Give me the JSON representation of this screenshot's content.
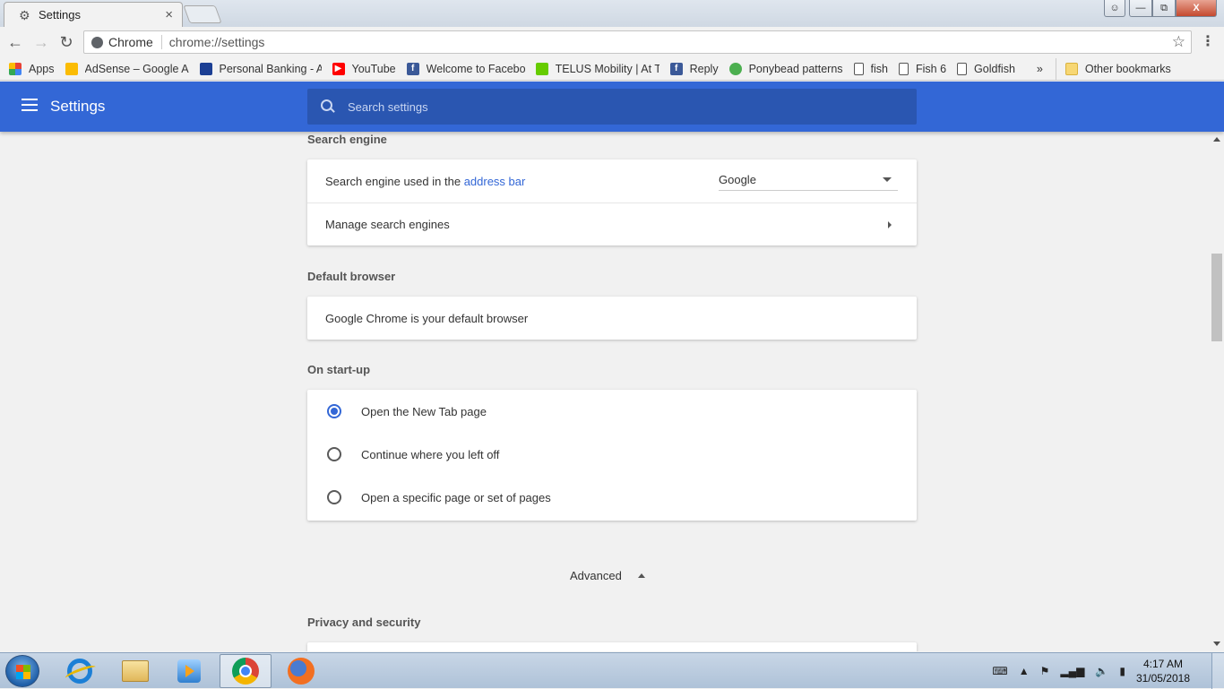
{
  "window": {
    "tab_title": "Settings",
    "tab_close": "×",
    "controls": {
      "close": "X"
    }
  },
  "toolbar": {
    "back": "←",
    "forward": "→",
    "reload": "↻",
    "site_name": "Chrome",
    "url": "chrome://settings",
    "star": "☆",
    "menu": "⋮"
  },
  "bookmarks": {
    "items": [
      {
        "label": "Apps",
        "icon": "apps-grid-icon",
        "color": "#e94235"
      },
      {
        "label": "AdSense – Google A",
        "icon": "adsense-icon",
        "color": "#fbbc04"
      },
      {
        "label": "Personal Banking - A",
        "icon": "rbc-icon",
        "color": "#1c3f94"
      },
      {
        "label": "YouTube",
        "icon": "youtube-icon",
        "color": "#ff0000"
      },
      {
        "label": "Welcome to Faceboo",
        "icon": "facebook-icon",
        "color": "#3b5998"
      },
      {
        "label": "TELUS Mobility | At T",
        "icon": "telus-icon",
        "color": "#66cc00"
      },
      {
        "label": "Reply",
        "icon": "facebook-icon",
        "color": "#3b5998"
      },
      {
        "label": "Ponybead patterns",
        "icon": "ponybead-icon",
        "color": "#4caf50"
      },
      {
        "label": "fish",
        "icon": "page-icon",
        "color": "#ffffff"
      },
      {
        "label": "Fish 6",
        "icon": "page-icon",
        "color": "#ffffff"
      },
      {
        "label": "Goldfish",
        "icon": "page-icon",
        "color": "#ffffff"
      }
    ],
    "overflow": "»",
    "other": "Other bookmarks"
  },
  "header": {
    "title": "Settings",
    "search_placeholder": "Search settings",
    "accent": "#3367d6"
  },
  "sections": {
    "search_engine": {
      "title": "Search engine",
      "used_in_prefix": "Search engine used in the",
      "used_in_link": "address bar",
      "selected_engine": "Google",
      "manage": "Manage search engines"
    },
    "default_browser": {
      "title": "Default browser",
      "status": "Google Chrome is your default browser"
    },
    "startup": {
      "title": "On start-up",
      "options": [
        {
          "label": "Open the New Tab page",
          "checked": true
        },
        {
          "label": "Continue where you left off",
          "checked": false
        },
        {
          "label": "Open a specific page or set of pages",
          "checked": false
        }
      ]
    },
    "advanced": "Advanced",
    "privacy": {
      "title": "Privacy and security"
    }
  },
  "taskbar": {
    "apps": [
      "internet-explorer-icon",
      "file-explorer-icon",
      "media-player-icon",
      "chrome-icon",
      "firefox-icon"
    ],
    "clock_time": "4:17 AM",
    "clock_date": "31/05/2018"
  }
}
